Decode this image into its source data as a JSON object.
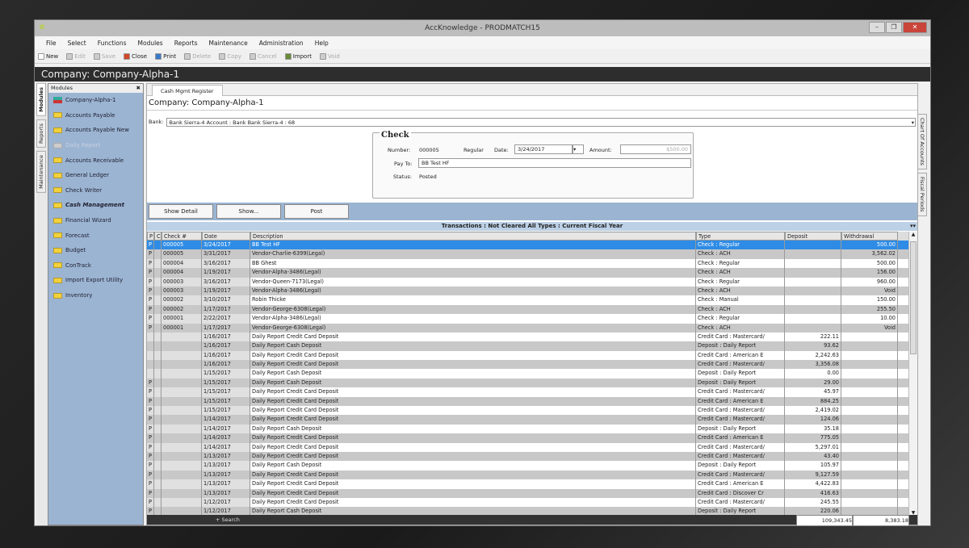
{
  "window": {
    "title": "AccKnowledge - PRODMATCH15",
    "controls": [
      "–",
      "❐",
      "✕"
    ]
  },
  "menu": [
    "File",
    "Select",
    "Functions",
    "Modules",
    "Reports",
    "Maintenance",
    "Administration",
    "Help"
  ],
  "toolbar": [
    {
      "label": "New",
      "enabled": true,
      "color": "#ffffff"
    },
    {
      "label": "Edit",
      "enabled": false,
      "color": "#cccccc"
    },
    {
      "label": "Save",
      "enabled": false,
      "color": "#cccccc"
    },
    {
      "label": "Close",
      "enabled": true,
      "color": "#d2482a"
    },
    {
      "label": "Print",
      "enabled": true,
      "color": "#3a78c8"
    },
    {
      "label": "Delete",
      "enabled": false,
      "color": "#cccccc"
    },
    {
      "label": "Copy",
      "enabled": false,
      "color": "#cccccc"
    },
    {
      "label": "Cancel",
      "enabled": false,
      "color": "#cccccc"
    },
    {
      "label": "Import",
      "enabled": true,
      "color": "#6a8a3a"
    },
    {
      "label": "Void",
      "enabled": false,
      "color": "#cccccc"
    }
  ],
  "company_bar": "Company: Company-Alpha-1",
  "left_tabs": [
    "Modules",
    "Reports",
    "Maintenance"
  ],
  "modules": {
    "header": "Modules",
    "close": "✖",
    "items": [
      {
        "label": "Company-Alpha-1",
        "type": "company"
      },
      {
        "label": "Accounts Payable"
      },
      {
        "label": "Accounts Payable New"
      },
      {
        "label": "Daily Report",
        "disabled": true
      },
      {
        "label": "Accounts Receivable"
      },
      {
        "label": "General Ledger"
      },
      {
        "label": "Check Writer"
      },
      {
        "label": "Cash Management",
        "active": true
      },
      {
        "label": "Financial Wizard"
      },
      {
        "label": "Forecast"
      },
      {
        "label": "Budget"
      },
      {
        "label": "ConTrack"
      },
      {
        "label": "Import Export Utility"
      },
      {
        "label": "Inventory"
      }
    ]
  },
  "doc_tab": "Cash Mgmt Register",
  "content_title": "Company: Company-Alpha-1",
  "bank": {
    "label": "Bank:",
    "value": "Bank Sierra-4 Account : Bank Bank Sierra-4 : 68"
  },
  "check": {
    "legend": "Check",
    "number_label": "Number:",
    "number": "000005",
    "type": "Regular",
    "date_label": "Date:",
    "date": "3/24/2017",
    "amount_label": "Amount:",
    "amount": "$500.00",
    "payto_label": "Pay To:",
    "payto": "BB Test HF",
    "status_label": "Status:",
    "status": "Posted"
  },
  "buttons": [
    "Show Detail",
    "Show...",
    "Post"
  ],
  "table": {
    "title": "Transactions : Not Cleared All Types : Current Fiscal Year",
    "columns": [
      "P",
      "C",
      "Check #",
      "Date",
      "Description",
      "Type",
      "Deposit",
      "Withdrawal"
    ],
    "rows": [
      [
        "P",
        "",
        "000005",
        "3/24/2017",
        "BB Test HF",
        "Check : Regular",
        "",
        "500.00"
      ],
      [
        "P",
        "",
        "000005",
        "3/31/2017",
        "Vendor-Charlie-6399(Legal)",
        "Check : ACH",
        "",
        "3,562.02"
      ],
      [
        "P",
        "",
        "000004",
        "3/16/2017",
        "BB Ghest",
        "Check : Regular",
        "",
        "500.00"
      ],
      [
        "P",
        "",
        "000004",
        "1/19/2017",
        "Vendor-Alpha-3486(Legal)",
        "Check : ACH",
        "",
        "156.00"
      ],
      [
        "P",
        "",
        "000003",
        "3/16/2017",
        "Vendor-Queen-7173(Legal)",
        "Check : Regular",
        "",
        "960.00"
      ],
      [
        "P",
        "",
        "000003",
        "1/19/2017",
        "Vendor-Alpha-3486(Legal)",
        "Check : ACH",
        "",
        "Void"
      ],
      [
        "P",
        "",
        "000002",
        "3/10/2017",
        "Robin Thicke",
        "Check : Manual",
        "",
        "150.00"
      ],
      [
        "P",
        "",
        "000002",
        "1/17/2017",
        "Vendor-George-6308(Legal)",
        "Check : ACH",
        "",
        "255.50"
      ],
      [
        "P",
        "",
        "000001",
        "2/22/2017",
        "Vendor-Alpha-3486(Legal)",
        "Check : Regular",
        "",
        "10.00"
      ],
      [
        "P",
        "",
        "000001",
        "1/17/2017",
        "Vendor-George-6308(Legal)",
        "Check : ACH",
        "",
        "Void"
      ],
      [
        "",
        "",
        "",
        "1/16/2017",
        "Daily Report Credit Card Deposit",
        "Credit Card : Mastercard/",
        "222.11",
        ""
      ],
      [
        "",
        "",
        "",
        "1/16/2017",
        "Daily Report Cash Deposit",
        "Deposit : Daily Report",
        "93.62",
        ""
      ],
      [
        "",
        "",
        "",
        "1/16/2017",
        "Daily Report Credit Card Deposit",
        "Credit Card : American E",
        "2,242.63",
        ""
      ],
      [
        "",
        "",
        "",
        "1/16/2017",
        "Daily Report Credit Card Deposit",
        "Credit Card : Mastercard/",
        "3,356.08",
        ""
      ],
      [
        "",
        "",
        "",
        "1/15/2017",
        "Daily Report Cash Deposit",
        "Deposit : Daily Report",
        "0.00",
        ""
      ],
      [
        "P",
        "",
        "",
        "1/15/2017",
        "Daily Report Cash Deposit",
        "Deposit : Daily Report",
        "29.00",
        ""
      ],
      [
        "P",
        "",
        "",
        "1/15/2017",
        "Daily Report Credit Card Deposit",
        "Credit Card : Mastercard/",
        "45.97",
        ""
      ],
      [
        "P",
        "",
        "",
        "1/15/2017",
        "Daily Report Credit Card Deposit",
        "Credit Card : American E",
        "884.25",
        ""
      ],
      [
        "P",
        "",
        "",
        "1/15/2017",
        "Daily Report Credit Card Deposit",
        "Credit Card : Mastercard/",
        "2,419.02",
        ""
      ],
      [
        "P",
        "",
        "",
        "1/14/2017",
        "Daily Report Credit Card Deposit",
        "Credit Card : Mastercard/",
        "124.06",
        ""
      ],
      [
        "P",
        "",
        "",
        "1/14/2017",
        "Daily Report Cash Deposit",
        "Deposit : Daily Report",
        "35.18",
        ""
      ],
      [
        "P",
        "",
        "",
        "1/14/2017",
        "Daily Report Credit Card Deposit",
        "Credit Card : American E",
        "775.05",
        ""
      ],
      [
        "P",
        "",
        "",
        "1/14/2017",
        "Daily Report Credit Card Deposit",
        "Credit Card : Mastercard/",
        "5,297.01",
        ""
      ],
      [
        "P",
        "",
        "",
        "1/13/2017",
        "Daily Report Credit Card Deposit",
        "Credit Card : Mastercard/",
        "43.40",
        ""
      ],
      [
        "P",
        "",
        "",
        "1/13/2017",
        "Daily Report Cash Deposit",
        "Deposit : Daily Report",
        "105.97",
        ""
      ],
      [
        "P",
        "",
        "",
        "1/13/2017",
        "Daily Report Credit Card Deposit",
        "Credit Card : Mastercard/",
        "9,127.59",
        ""
      ],
      [
        "P",
        "",
        "",
        "1/13/2017",
        "Daily Report Credit Card Deposit",
        "Credit Card : American E",
        "4,422.83",
        ""
      ],
      [
        "P",
        "",
        "",
        "1/13/2017",
        "Daily Report Credit Card Deposit",
        "Credit Card : Discover Cr",
        "416.63",
        ""
      ],
      [
        "P",
        "",
        "",
        "1/12/2017",
        "Daily Report Credit Card Deposit",
        "Credit Card : Mastercard/",
        "245.55",
        ""
      ],
      [
        "P",
        "",
        "",
        "1/12/2017",
        "Daily Report Cash Deposit",
        "Deposit : Daily Report",
        "220.06",
        ""
      ]
    ],
    "search_label": "+ Search",
    "total_deposit": "109,343.45",
    "total_withdrawal": "8,383.18"
  },
  "right_tabs": [
    "Chart Of Accounts",
    "Fiscal Periods"
  ]
}
